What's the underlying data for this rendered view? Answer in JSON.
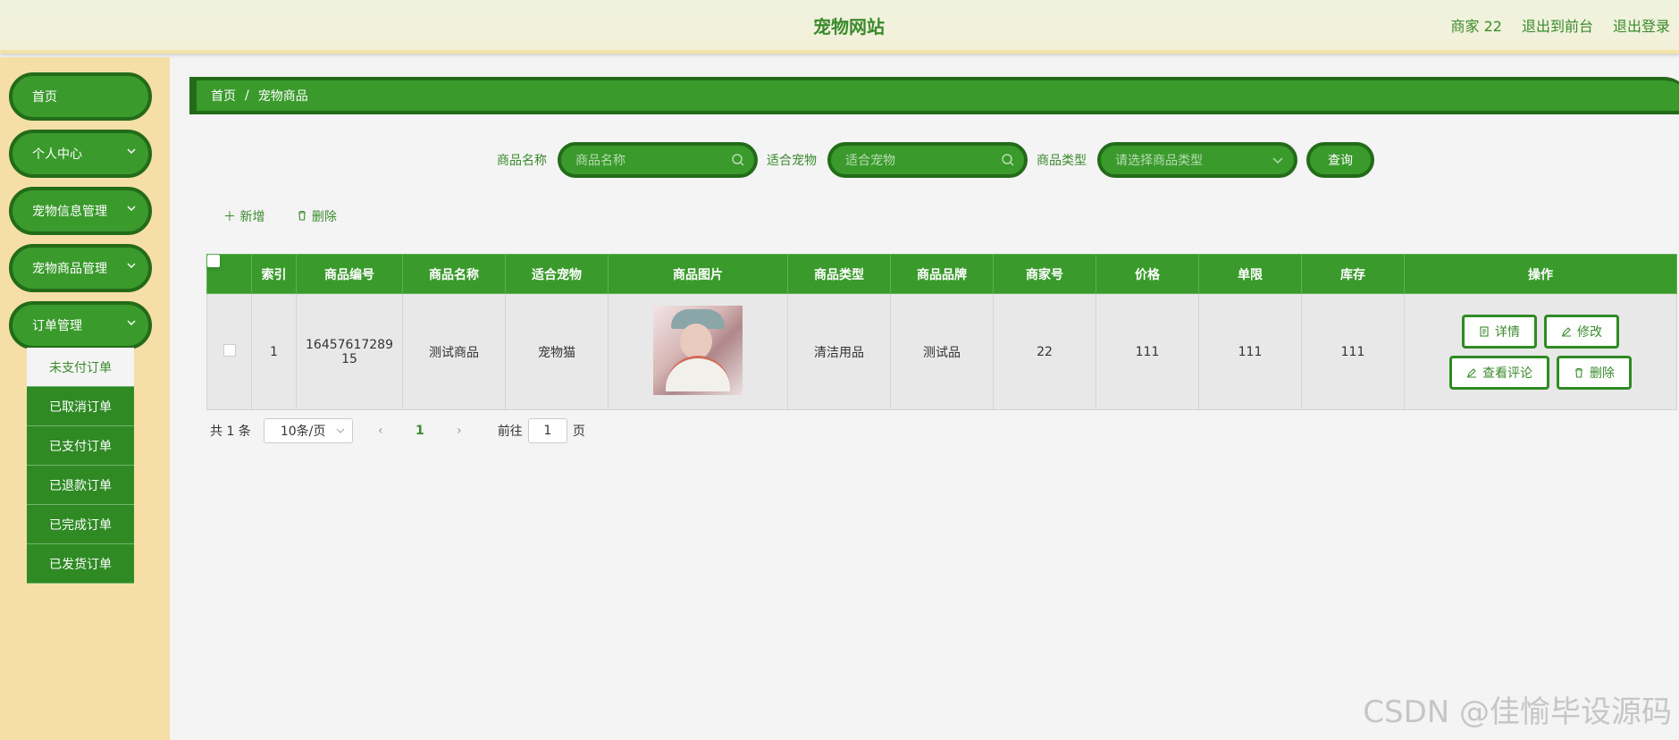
{
  "header": {
    "title": "宠物网站",
    "user": "商家 22",
    "front_link": "退出到前台",
    "logout_link": "退出登录"
  },
  "sidebar": {
    "items": [
      {
        "label": "首页"
      },
      {
        "label": "个人中心"
      },
      {
        "label": "宠物信息管理"
      },
      {
        "label": "宠物商品管理"
      },
      {
        "label": "订单管理"
      }
    ],
    "submenu": [
      {
        "label": "未支付订单"
      },
      {
        "label": "已取消订单"
      },
      {
        "label": "已支付订单"
      },
      {
        "label": "已退款订单"
      },
      {
        "label": "已完成订单"
      },
      {
        "label": "已发货订单"
      }
    ]
  },
  "breadcrumb": {
    "home": "首页",
    "sep": "/",
    "current": "宠物商品"
  },
  "search": {
    "name_label": "商品名称",
    "name_placeholder": "商品名称",
    "pet_label": "适合宠物",
    "pet_placeholder": "适合宠物",
    "type_label": "商品类型",
    "type_placeholder": "请选择商品类型",
    "query_label": "查询"
  },
  "actions": {
    "add": "＋ 新增",
    "delete": "删除"
  },
  "table": {
    "headers": [
      "索引",
      "商品编号",
      "商品名称",
      "适合宠物",
      "商品图片",
      "商品类型",
      "商品品牌",
      "商家号",
      "价格",
      "单限",
      "库存",
      "操作"
    ],
    "rows": [
      {
        "index": "1",
        "code_line1": "16457617289",
        "code_line2": "15",
        "name": "测试商品",
        "pet": "宠物猫",
        "type": "清洁用品",
        "brand": "测试品",
        "merchant": "22",
        "price": "111",
        "limit": "111",
        "stock": "111"
      }
    ],
    "ops": {
      "detail": "详情",
      "edit": "修改",
      "review": "查看评论",
      "delete": "删除"
    }
  },
  "pager": {
    "total": "共 1 条",
    "size": "10条/页",
    "prev": "‹",
    "current": "1",
    "next": "›",
    "goto": "前往",
    "goto_value": "1",
    "page_suffix": "页"
  },
  "watermark": "CSDN @佳愉毕设源码",
  "colors": {
    "primary": "#3a9a2c",
    "dark": "#236b19",
    "sidebar_bg": "#f5dfa6"
  }
}
